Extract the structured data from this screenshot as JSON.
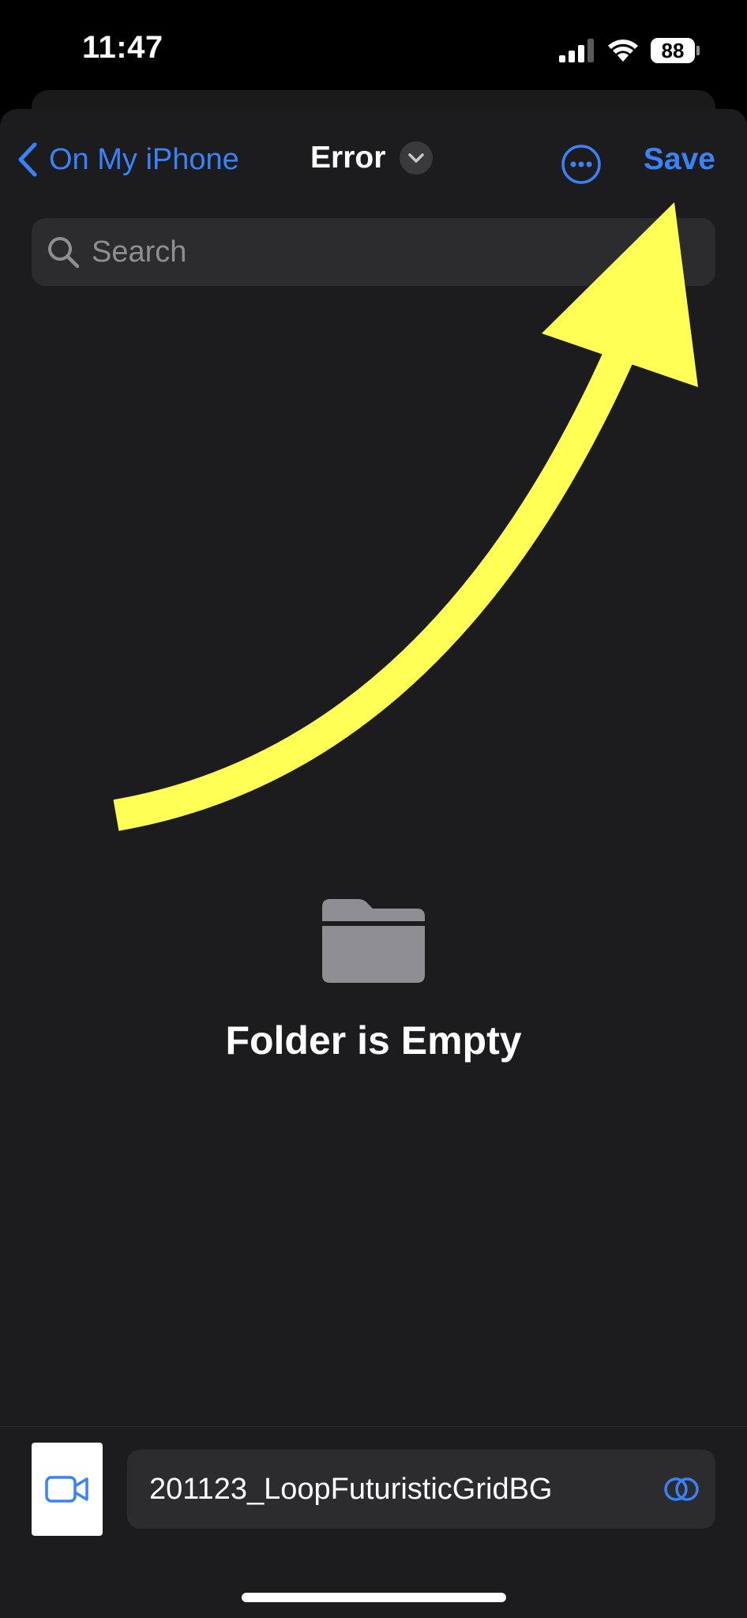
{
  "status_bar": {
    "time": "11:47",
    "battery": "88",
    "signal_icon": "cellular-signal-icon",
    "wifi_icon": "wifi-icon"
  },
  "nav": {
    "back_label": "On My iPhone",
    "title": "Error",
    "save_label": "Save",
    "accent_color": "#3a82f7"
  },
  "search": {
    "placeholder": "Search"
  },
  "empty_state": {
    "message": "Folder is Empty",
    "icon": "folder-icon"
  },
  "file": {
    "name": "201123_LoopFuturisticGridBG",
    "thumbnail_icon": "video-camera-icon"
  },
  "annotation": {
    "arrow_color": "#ffff55"
  }
}
